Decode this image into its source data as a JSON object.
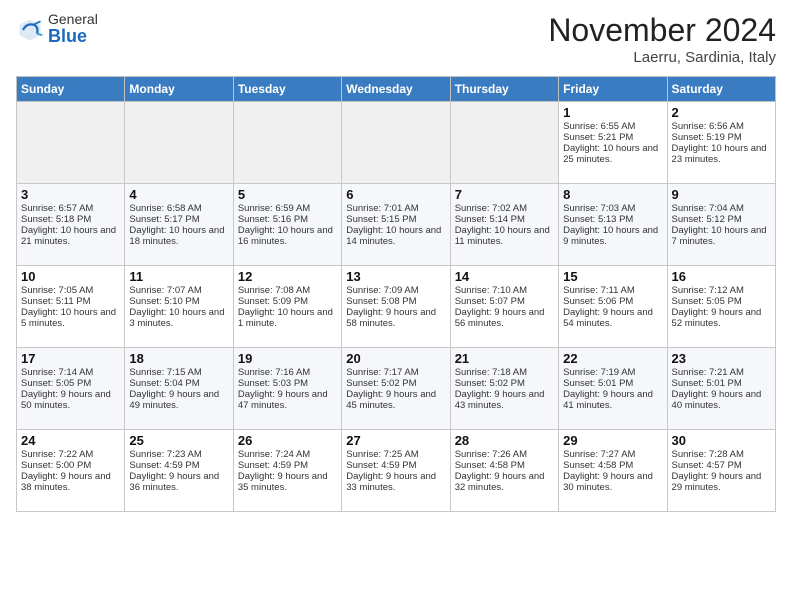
{
  "logo": {
    "general": "General",
    "blue": "Blue"
  },
  "title": "November 2024",
  "location": "Laerru, Sardinia, Italy",
  "days_of_week": [
    "Sunday",
    "Monday",
    "Tuesday",
    "Wednesday",
    "Thursday",
    "Friday",
    "Saturday"
  ],
  "weeks": [
    [
      {
        "day": "",
        "empty": true
      },
      {
        "day": "",
        "empty": true
      },
      {
        "day": "",
        "empty": true
      },
      {
        "day": "",
        "empty": true
      },
      {
        "day": "",
        "empty": true
      },
      {
        "day": "1",
        "sunrise": "Sunrise: 6:55 AM",
        "sunset": "Sunset: 5:21 PM",
        "daylight": "Daylight: 10 hours and 25 minutes."
      },
      {
        "day": "2",
        "sunrise": "Sunrise: 6:56 AM",
        "sunset": "Sunset: 5:19 PM",
        "daylight": "Daylight: 10 hours and 23 minutes."
      }
    ],
    [
      {
        "day": "3",
        "sunrise": "Sunrise: 6:57 AM",
        "sunset": "Sunset: 5:18 PM",
        "daylight": "Daylight: 10 hours and 21 minutes."
      },
      {
        "day": "4",
        "sunrise": "Sunrise: 6:58 AM",
        "sunset": "Sunset: 5:17 PM",
        "daylight": "Daylight: 10 hours and 18 minutes."
      },
      {
        "day": "5",
        "sunrise": "Sunrise: 6:59 AM",
        "sunset": "Sunset: 5:16 PM",
        "daylight": "Daylight: 10 hours and 16 minutes."
      },
      {
        "day": "6",
        "sunrise": "Sunrise: 7:01 AM",
        "sunset": "Sunset: 5:15 PM",
        "daylight": "Daylight: 10 hours and 14 minutes."
      },
      {
        "day": "7",
        "sunrise": "Sunrise: 7:02 AM",
        "sunset": "Sunset: 5:14 PM",
        "daylight": "Daylight: 10 hours and 11 minutes."
      },
      {
        "day": "8",
        "sunrise": "Sunrise: 7:03 AM",
        "sunset": "Sunset: 5:13 PM",
        "daylight": "Daylight: 10 hours and 9 minutes."
      },
      {
        "day": "9",
        "sunrise": "Sunrise: 7:04 AM",
        "sunset": "Sunset: 5:12 PM",
        "daylight": "Daylight: 10 hours and 7 minutes."
      }
    ],
    [
      {
        "day": "10",
        "sunrise": "Sunrise: 7:05 AM",
        "sunset": "Sunset: 5:11 PM",
        "daylight": "Daylight: 10 hours and 5 minutes."
      },
      {
        "day": "11",
        "sunrise": "Sunrise: 7:07 AM",
        "sunset": "Sunset: 5:10 PM",
        "daylight": "Daylight: 10 hours and 3 minutes."
      },
      {
        "day": "12",
        "sunrise": "Sunrise: 7:08 AM",
        "sunset": "Sunset: 5:09 PM",
        "daylight": "Daylight: 10 hours and 1 minute."
      },
      {
        "day": "13",
        "sunrise": "Sunrise: 7:09 AM",
        "sunset": "Sunset: 5:08 PM",
        "daylight": "Daylight: 9 hours and 58 minutes."
      },
      {
        "day": "14",
        "sunrise": "Sunrise: 7:10 AM",
        "sunset": "Sunset: 5:07 PM",
        "daylight": "Daylight: 9 hours and 56 minutes."
      },
      {
        "day": "15",
        "sunrise": "Sunrise: 7:11 AM",
        "sunset": "Sunset: 5:06 PM",
        "daylight": "Daylight: 9 hours and 54 minutes."
      },
      {
        "day": "16",
        "sunrise": "Sunrise: 7:12 AM",
        "sunset": "Sunset: 5:05 PM",
        "daylight": "Daylight: 9 hours and 52 minutes."
      }
    ],
    [
      {
        "day": "17",
        "sunrise": "Sunrise: 7:14 AM",
        "sunset": "Sunset: 5:05 PM",
        "daylight": "Daylight: 9 hours and 50 minutes."
      },
      {
        "day": "18",
        "sunrise": "Sunrise: 7:15 AM",
        "sunset": "Sunset: 5:04 PM",
        "daylight": "Daylight: 9 hours and 49 minutes."
      },
      {
        "day": "19",
        "sunrise": "Sunrise: 7:16 AM",
        "sunset": "Sunset: 5:03 PM",
        "daylight": "Daylight: 9 hours and 47 minutes."
      },
      {
        "day": "20",
        "sunrise": "Sunrise: 7:17 AM",
        "sunset": "Sunset: 5:02 PM",
        "daylight": "Daylight: 9 hours and 45 minutes."
      },
      {
        "day": "21",
        "sunrise": "Sunrise: 7:18 AM",
        "sunset": "Sunset: 5:02 PM",
        "daylight": "Daylight: 9 hours and 43 minutes."
      },
      {
        "day": "22",
        "sunrise": "Sunrise: 7:19 AM",
        "sunset": "Sunset: 5:01 PM",
        "daylight": "Daylight: 9 hours and 41 minutes."
      },
      {
        "day": "23",
        "sunrise": "Sunrise: 7:21 AM",
        "sunset": "Sunset: 5:01 PM",
        "daylight": "Daylight: 9 hours and 40 minutes."
      }
    ],
    [
      {
        "day": "24",
        "sunrise": "Sunrise: 7:22 AM",
        "sunset": "Sunset: 5:00 PM",
        "daylight": "Daylight: 9 hours and 38 minutes."
      },
      {
        "day": "25",
        "sunrise": "Sunrise: 7:23 AM",
        "sunset": "Sunset: 4:59 PM",
        "daylight": "Daylight: 9 hours and 36 minutes."
      },
      {
        "day": "26",
        "sunrise": "Sunrise: 7:24 AM",
        "sunset": "Sunset: 4:59 PM",
        "daylight": "Daylight: 9 hours and 35 minutes."
      },
      {
        "day": "27",
        "sunrise": "Sunrise: 7:25 AM",
        "sunset": "Sunset: 4:59 PM",
        "daylight": "Daylight: 9 hours and 33 minutes."
      },
      {
        "day": "28",
        "sunrise": "Sunrise: 7:26 AM",
        "sunset": "Sunset: 4:58 PM",
        "daylight": "Daylight: 9 hours and 32 minutes."
      },
      {
        "day": "29",
        "sunrise": "Sunrise: 7:27 AM",
        "sunset": "Sunset: 4:58 PM",
        "daylight": "Daylight: 9 hours and 30 minutes."
      },
      {
        "day": "30",
        "sunrise": "Sunrise: 7:28 AM",
        "sunset": "Sunset: 4:57 PM",
        "daylight": "Daylight: 9 hours and 29 minutes."
      }
    ]
  ]
}
